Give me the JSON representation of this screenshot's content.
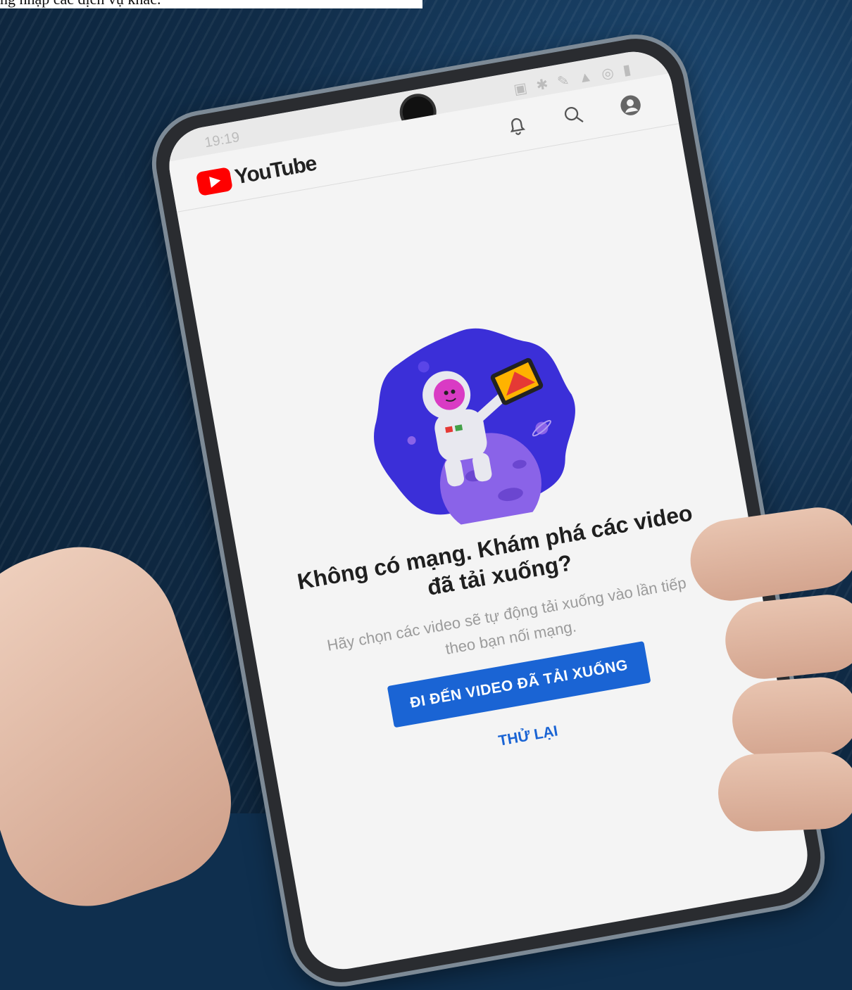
{
  "caption": "ng nhập các dịch vụ khác.",
  "statusbar": {
    "time": "19:19",
    "icons": "▣ ✱ ✎ ▲ ◎ ▮"
  },
  "appbar": {
    "brand": "YouTube",
    "icons": [
      "bell-icon",
      "search-icon",
      "account-icon"
    ]
  },
  "offline": {
    "headline": "Không có mạng. Khám phá các video đã tải xuống?",
    "subtext": "Hãy chọn các video sẽ tự động tải xuống vào lần tiếp theo bạn nối mạng.",
    "primary_button": "ĐI ĐẾN VIDEO ĐÃ TẢI XUỐNG",
    "secondary_button": "THỬ LẠI"
  },
  "colors": {
    "youtube_red": "#ff0000",
    "accent_blue": "#1a64d4",
    "illustration_blue": "#3b2fd8"
  }
}
